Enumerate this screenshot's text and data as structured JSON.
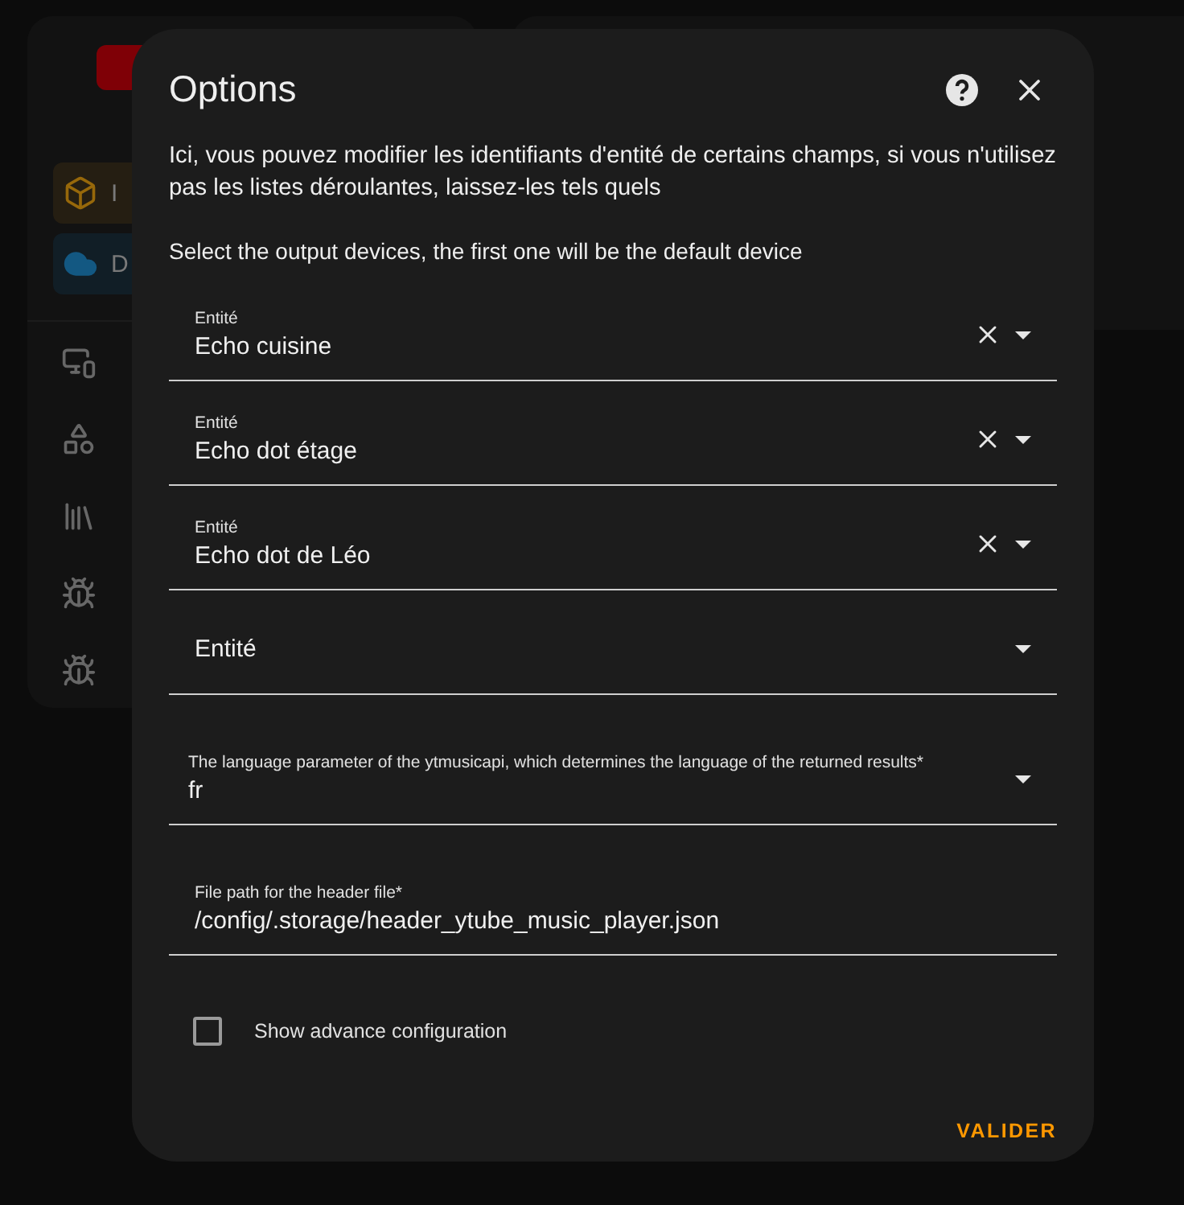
{
  "sidebar": {
    "items": [
      {
        "label": "I",
        "kind": "integration"
      },
      {
        "label": "D",
        "kind": "dependency"
      }
    ]
  },
  "dialog": {
    "title": "Options",
    "description": "Ici, vous pouvez modifier les identifiants d'entité de certains champs, si vous n'utilisez pas les listes déroulantes, laissez-les tels quels",
    "subtitle": "Select the output devices, the first one will be the default device",
    "entity_fields": [
      {
        "label": "Entité",
        "value": "Echo cuisine"
      },
      {
        "label": "Entité",
        "value": "Echo dot étage"
      },
      {
        "label": "Entité",
        "value": "Echo dot de Léo"
      },
      {
        "label": "Entité"
      }
    ],
    "language_field": {
      "label": "The language parameter of the ytmusicapi, which determines the language of the returned results*",
      "value": "fr"
    },
    "file_field": {
      "label": "File path for the header file*",
      "value": "/config/.storage/header_ytube_music_player.json"
    },
    "advanced_checkbox": {
      "label": "Show advance configuration",
      "checked": false
    },
    "submit_button": "VALIDER"
  }
}
